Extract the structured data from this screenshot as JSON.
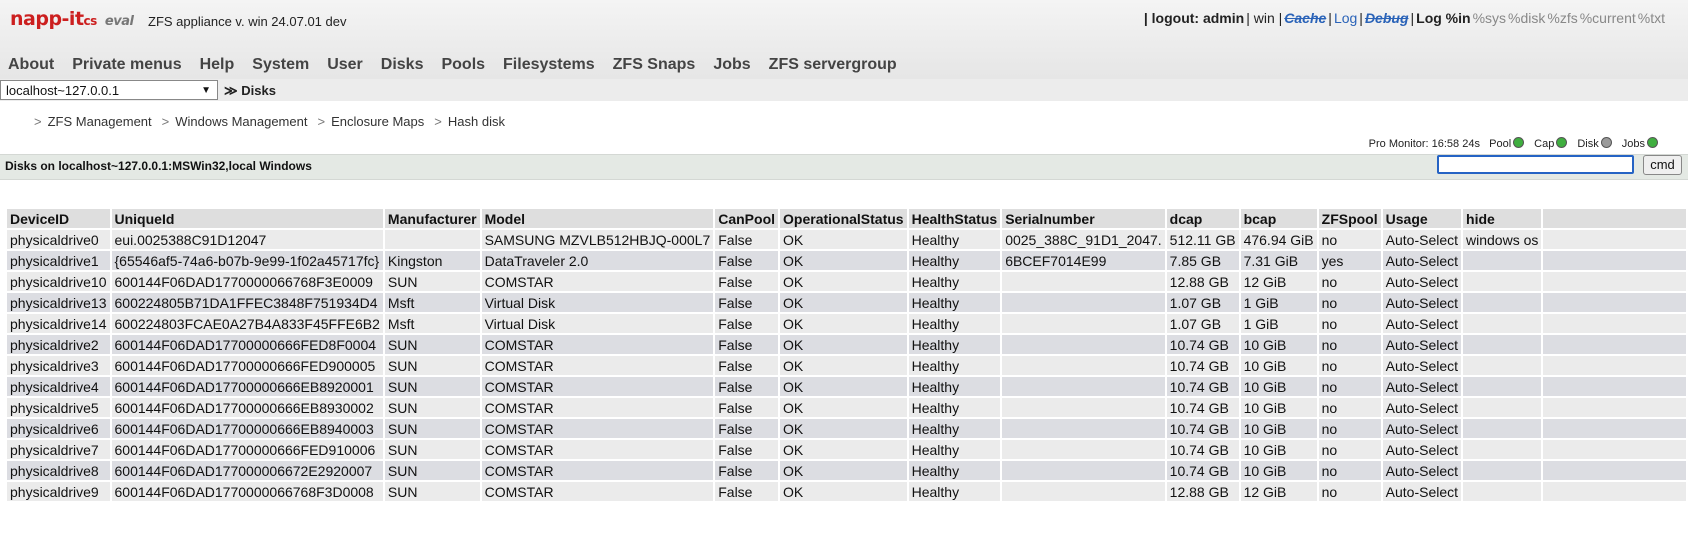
{
  "header": {
    "logo_main": "napp-it",
    "logo_cs": "cs",
    "logo_sub": "eval",
    "appliance": "ZFS appliance v. win 24.07.01 dev",
    "links": [
      {
        "label": "| logout: admin",
        "style": "bold"
      },
      {
        "label": "| win |",
        "style": "normal"
      },
      {
        "label": "Cache",
        "style": "strike"
      },
      {
        "label": "|",
        "style": "normal"
      },
      {
        "label": "Log",
        "style": "blue"
      },
      {
        "label": "|",
        "style": "normal"
      },
      {
        "label": "Debug",
        "style": "strike"
      },
      {
        "label": "|",
        "style": "normal"
      },
      {
        "label": "Log %in",
        "style": "bold"
      },
      {
        "label": "%sys",
        "style": "gray"
      },
      {
        "label": "%disk",
        "style": "gray"
      },
      {
        "label": "%zfs",
        "style": "gray"
      },
      {
        "label": "%current",
        "style": "gray"
      },
      {
        "label": "%txt",
        "style": "gray"
      }
    ]
  },
  "menu": [
    "About",
    "Private menus",
    "Help",
    "System",
    "User",
    "Disks",
    "Pools",
    "Filesystems",
    "ZFS Snaps",
    "Jobs",
    "ZFS servergroup"
  ],
  "server": {
    "selected": "localhost~127.0.0.1",
    "current_prefix": "≫",
    "current": "Disks"
  },
  "submenu": {
    "prefix": ">",
    "separator": ">",
    "items": [
      "ZFS Management",
      "Windows Management",
      "Enclosure Maps",
      "Hash disk"
    ]
  },
  "monitor": {
    "label": "Pro Monitor: 16:58 24s",
    "items": [
      {
        "label": "Pool",
        "color": "#3fae3f"
      },
      {
        "label": "Cap",
        "color": "#3fae3f"
      },
      {
        "label": "Disk",
        "color": "#9a9a9a"
      },
      {
        "label": "Jobs",
        "color": "#3fae3f"
      }
    ]
  },
  "status": {
    "title": "Disks on localhost~127.0.0.1:MSWin32,local Windows",
    "cmd_label": "cmd",
    "cmd_value": ""
  },
  "table": {
    "headers": [
      "DeviceID",
      "UniqueId",
      "Manufacturer",
      "Model",
      "CanPool",
      "OperationalStatus",
      "HealthStatus",
      "Serialnumber",
      "dcap",
      "bcap",
      "ZFSpool",
      "Usage",
      "hide",
      ""
    ],
    "rows": [
      [
        "physicaldrive0",
        "eui.0025388C91D12047",
        "",
        "SAMSUNG MZVLB512HBJQ-000L7",
        "False",
        "OK",
        "Healthy",
        "0025_388C_91D1_2047.",
        "512.11 GB",
        "476.94 GiB",
        "no",
        "Auto-Select",
        "windows os",
        ""
      ],
      [
        "physicaldrive1",
        "{65546af5-74a6-b07b-9e99-1f02a45717fc}",
        "Kingston",
        "DataTraveler 2.0",
        "False",
        "OK",
        "Healthy",
        "6BCEF7014E99",
        "7.85 GB",
        "7.31 GiB",
        "yes",
        "Auto-Select",
        "",
        ""
      ],
      [
        "physicaldrive10",
        "600144F06DAD1770000066768F3E0009",
        "SUN",
        "COMSTAR",
        "False",
        "OK",
        "Healthy",
        "",
        "12.88 GB",
        "12 GiB",
        "no",
        "Auto-Select",
        "",
        ""
      ],
      [
        "physicaldrive13",
        "600224805B71DA1FFEC3848F751934D4",
        "Msft",
        "Virtual Disk",
        "False",
        "OK",
        "Healthy",
        "",
        "1.07 GB",
        "1 GiB",
        "no",
        "Auto-Select",
        "",
        ""
      ],
      [
        "physicaldrive14",
        "600224803FCAE0A27B4A833F45FFE6B2",
        "Msft",
        "Virtual Disk",
        "False",
        "OK",
        "Healthy",
        "",
        "1.07 GB",
        "1 GiB",
        "no",
        "Auto-Select",
        "",
        ""
      ],
      [
        "physicaldrive2",
        "600144F06DAD17700000666FED8F0004",
        "SUN",
        "COMSTAR",
        "False",
        "OK",
        "Healthy",
        "",
        "10.74 GB",
        "10 GiB",
        "no",
        "Auto-Select",
        "",
        ""
      ],
      [
        "physicaldrive3",
        "600144F06DAD17700000666FED900005",
        "SUN",
        "COMSTAR",
        "False",
        "OK",
        "Healthy",
        "",
        "10.74 GB",
        "10 GiB",
        "no",
        "Auto-Select",
        "",
        ""
      ],
      [
        "physicaldrive4",
        "600144F06DAD17700000666EB8920001",
        "SUN",
        "COMSTAR",
        "False",
        "OK",
        "Healthy",
        "",
        "10.74 GB",
        "10 GiB",
        "no",
        "Auto-Select",
        "",
        ""
      ],
      [
        "physicaldrive5",
        "600144F06DAD17700000666EB8930002",
        "SUN",
        "COMSTAR",
        "False",
        "OK",
        "Healthy",
        "",
        "10.74 GB",
        "10 GiB",
        "no",
        "Auto-Select",
        "",
        ""
      ],
      [
        "physicaldrive6",
        "600144F06DAD17700000666EB8940003",
        "SUN",
        "COMSTAR",
        "False",
        "OK",
        "Healthy",
        "",
        "10.74 GB",
        "10 GiB",
        "no",
        "Auto-Select",
        "",
        ""
      ],
      [
        "physicaldrive7",
        "600144F06DAD17700000666FED910006",
        "SUN",
        "COMSTAR",
        "False",
        "OK",
        "Healthy",
        "",
        "10.74 GB",
        "10 GiB",
        "no",
        "Auto-Select",
        "",
        ""
      ],
      [
        "physicaldrive8",
        "600144F06DAD177000006672E2920007",
        "SUN",
        "COMSTAR",
        "False",
        "OK",
        "Healthy",
        "",
        "10.74 GB",
        "10 GiB",
        "no",
        "Auto-Select",
        "",
        ""
      ],
      [
        "physicaldrive9",
        "600144F06DAD1770000066768F3D0008",
        "SUN",
        "COMSTAR",
        "False",
        "OK",
        "Healthy",
        "",
        "12.88 GB",
        "12 GiB",
        "no",
        "Auto-Select",
        "",
        ""
      ]
    ]
  }
}
